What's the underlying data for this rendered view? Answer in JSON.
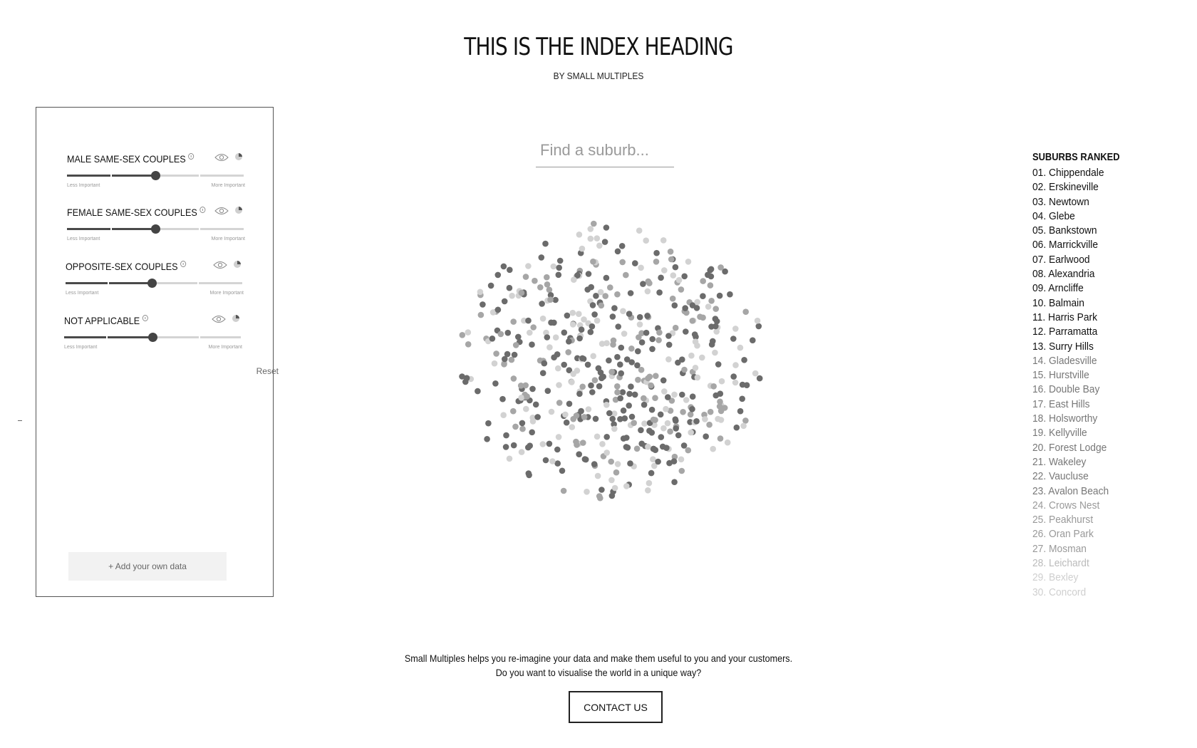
{
  "header": {
    "title": "THIS IS THE INDEX HEADING",
    "subtitle": "BY SMALL MULTIPLES"
  },
  "panel": {
    "variables": [
      {
        "label": "MALE SAME-SEX COUPLES",
        "importance": 0.5,
        "less_label": "Less Important",
        "more_label": "More Important",
        "eye_icon": "eye-icon",
        "pie_icon": "pie-chart-icon"
      },
      {
        "label": "FEMALE SAME-SEX COUPLES",
        "importance": 0.5,
        "less_label": "Less Important",
        "more_label": "More Important",
        "eye_icon": "eye-icon",
        "pie_icon": "pie-chart-icon"
      },
      {
        "label": "OPPOSITE-SEX COUPLES",
        "importance": 0.5,
        "less_label": "Less Important",
        "more_label": "More Important",
        "eye_icon": "eye-icon",
        "pie_icon": "pie-chart-icon"
      },
      {
        "label": "NOT APPLICABLE",
        "importance": 0.5,
        "less_label": "Less Important",
        "more_label": "More Important",
        "eye_icon": "eye-icon",
        "pie_icon": "pie-chart-icon"
      }
    ],
    "reset_label": "Reset",
    "add_data_label": "+ Add your own data"
  },
  "search": {
    "placeholder": "Find a suburb..."
  },
  "ranking": {
    "title": "SUBURBS RANKED",
    "items": [
      "01. Chippendale",
      "02. Erskineville",
      "03. Newtown",
      "04. Glebe",
      "05. Bankstown",
      "06. Marrickville",
      "07. Earlwood",
      "08. Alexandria",
      "09. Arncliffe",
      "10. Balmain",
      "11. Harris Park",
      "12. Parramatta",
      "13. Surry Hills",
      "14. Gladesville",
      "15. Hurstville",
      "16. Double Bay",
      "17. East Hills",
      "18. Holsworthy",
      "19. Kellyville",
      "20. Forest Lodge",
      "21. Wakeley",
      "22. Vaucluse",
      "23. Avalon Beach",
      "24. Crows Nest",
      "25. Peakhurst",
      "26. Oran Park",
      "27. Mosman",
      "28. Leichardt",
      "29. Bexley",
      "30. Concord"
    ]
  },
  "footer": {
    "line1": "Small Multiples helps you re-imagine your data and make them useful to you and your customers.",
    "line2": "Do you want to visualise the world in a unique way?",
    "contact_label": "CONTACT US"
  },
  "colors": {
    "dot_dark": "#6b6b6b",
    "dot_mid": "#a6a6a6",
    "dot_light": "#d2d2d2",
    "slider_fill": "#4a4a4a",
    "slider_rail": "#d4d4d4"
  }
}
